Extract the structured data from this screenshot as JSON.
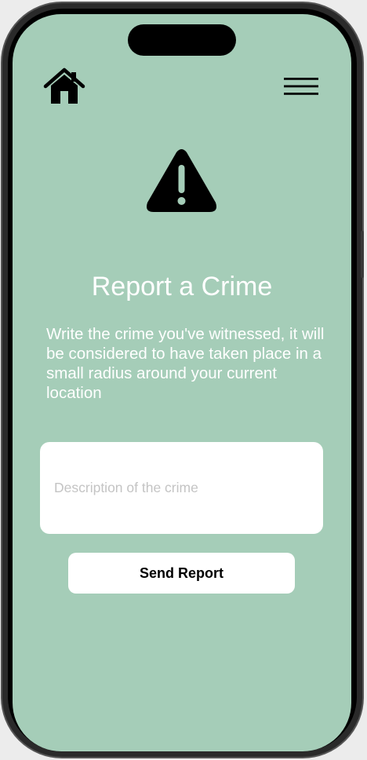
{
  "header": {
    "home_icon": "home-icon",
    "menu_icon": "hamburger-menu-icon"
  },
  "main": {
    "alert_icon": "warning-icon",
    "title": "Report a Crime",
    "description": "Write the crime you've witnessed, it will be considered to have taken place in a small radius around your current location",
    "input": {
      "placeholder": "Description of the crime",
      "value": ""
    },
    "send_label": "Send Report"
  },
  "colors": {
    "background": "#a5cdb8",
    "text": "#ffffff",
    "icon": "#000000",
    "card": "#ffffff"
  }
}
